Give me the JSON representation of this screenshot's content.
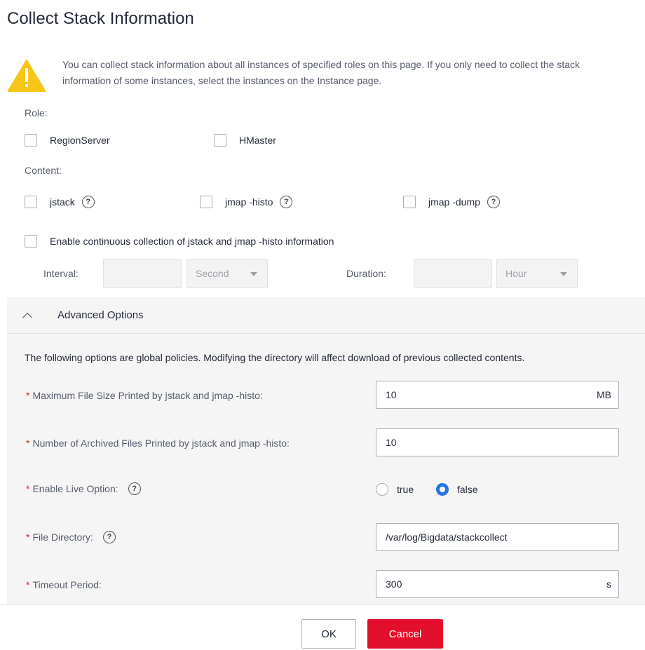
{
  "title": "Collect Stack Information",
  "notice": "You can collect stack information about all instances of specified roles on this page. If you only need to collect the stack information of some instances, select the instances on the Instance page.",
  "role": {
    "label": "Role:",
    "options": [
      "RegionServer",
      "HMaster"
    ]
  },
  "content": {
    "label": "Content:",
    "options": [
      "jstack",
      "jmap -histo",
      "jmap -dump"
    ]
  },
  "continuous": {
    "label": "Enable continuous collection of jstack and jmap -histo information",
    "interval_label": "Interval:",
    "interval_unit": "Second",
    "duration_label": "Duration:",
    "duration_unit": "Hour"
  },
  "advanced": {
    "title": "Advanced Options",
    "note": "The following options are global policies. Modifying the directory will affect download of previous collected contents.",
    "max_file_size": {
      "label": "Maximum File Size Printed by jstack and jmap -histo:",
      "value": "10",
      "unit": "MB"
    },
    "archived_files": {
      "label": "Number of Archived Files Printed by jstack and jmap -histo:",
      "value": "10"
    },
    "live_option": {
      "label": "Enable Live Option:",
      "options": [
        "true",
        "false"
      ],
      "selected": "false"
    },
    "file_directory": {
      "label": "File Directory:",
      "value": "/var/log/Bigdata/stackcollect"
    },
    "timeout": {
      "label": "Timeout Period:",
      "value": "300",
      "unit": "s"
    }
  },
  "footer": {
    "ok_label": "OK",
    "cancel_label": "Cancel"
  },
  "colors": {
    "warning": "#f7c518",
    "primary": "#2574e6",
    "danger": "#e30e2b",
    "required": "#e02020"
  },
  "required_mark": "*",
  "help_glyph": "?"
}
